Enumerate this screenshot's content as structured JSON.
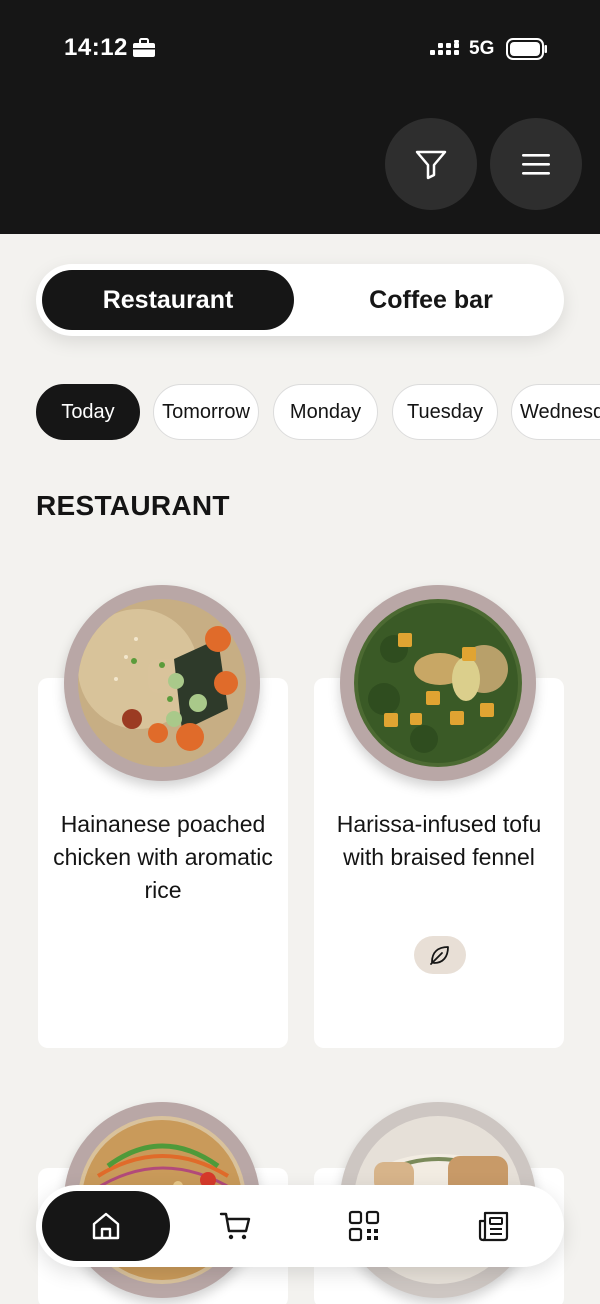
{
  "status_bar": {
    "time": "14:12",
    "network": "5G"
  },
  "header": {
    "filter_icon": "filter-icon",
    "menu_icon": "menu-icon"
  },
  "segment": {
    "active": "Restaurant",
    "inactive": "Coffee bar"
  },
  "days": [
    "Today",
    "Tomorrow",
    "Monday",
    "Tuesday",
    "Wednesday"
  ],
  "section": {
    "title": "RESTAURANT"
  },
  "dishes": [
    {
      "name": "Hainanese poached chicken with aromatic rice",
      "vegetarian": false
    },
    {
      "name": "Harissa-infused tofu with braised fennel",
      "vegetarian": true
    }
  ],
  "bottom_nav": [
    "home-icon",
    "cart-icon",
    "qr-code-icon",
    "news-icon"
  ],
  "colors": {
    "dark": "#161616",
    "background": "#f3f2ef",
    "veg_badge": "#e8dfd6"
  }
}
